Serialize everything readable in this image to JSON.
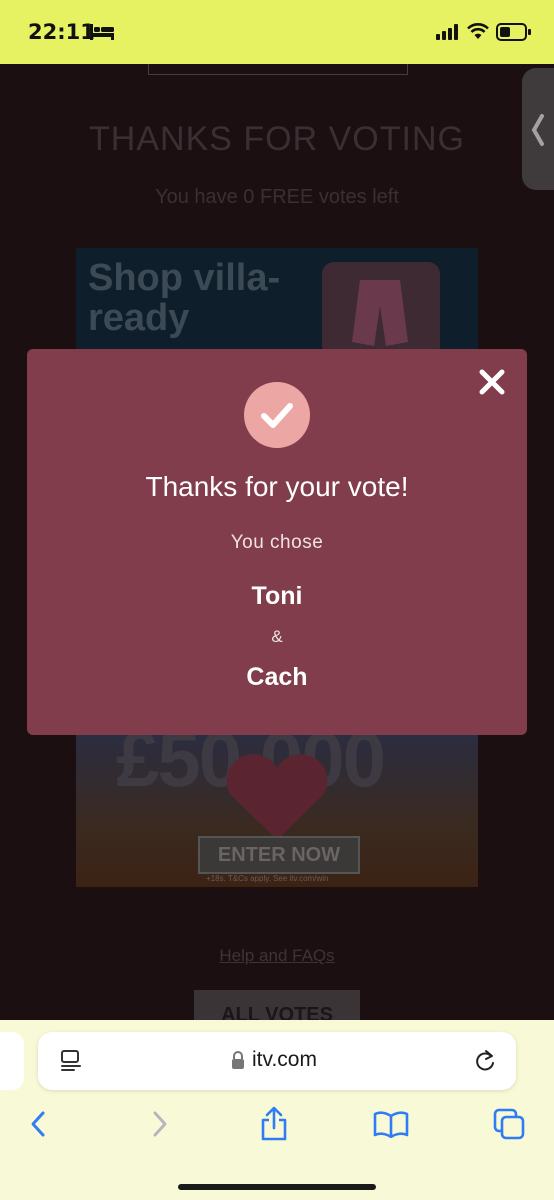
{
  "status_bar": {
    "time": "22:11",
    "icons": [
      "bed-icon",
      "signal-icon",
      "wifi-icon",
      "battery-icon"
    ]
  },
  "page": {
    "title": "THANKS FOR VOTING",
    "free_votes": "You have 0 FREE votes left",
    "ad_top_text": "Shop villa-ready",
    "ad_bottom_prize": "£50,000",
    "ad_bottom_button": "ENTER NOW",
    "ad_bottom_small": "+18s. T&Cs apply. See itv.com/win",
    "help_link": "Help and FAQs",
    "all_votes_button": "ALL VOTES"
  },
  "modal": {
    "title": "Thanks for your vote!",
    "subtitle": "You chose",
    "choice_1": "Toni",
    "separator": "&",
    "choice_2": "Cach",
    "close_icon": "close-icon",
    "check_icon": "check-icon"
  },
  "browser": {
    "url": "itv.com",
    "toolbar_icons": [
      "back-icon",
      "forward-icon",
      "share-icon",
      "bookmarks-icon",
      "tabs-icon"
    ]
  },
  "colors": {
    "status_bar_bg": "#e6f261",
    "modal_bg": "#813d4c",
    "check_circle": "#eca7a4",
    "browser_accent": "#2f7cf6"
  }
}
